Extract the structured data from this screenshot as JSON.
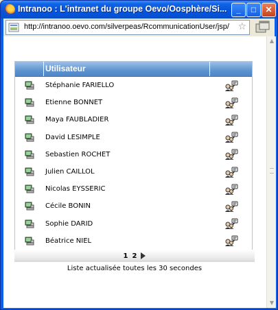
{
  "window": {
    "title": "Intranoo : L'intranet du groupe Oevo/Oosphère/Si..."
  },
  "address_bar": {
    "url": "http://intranoo.oevo.com/silverpeas/RcommunicationUser/jsp/"
  },
  "table": {
    "header": "Utilisateur",
    "users": [
      "Stéphanie FARIELLO",
      "Etienne BONNET",
      "Maya FAUBLADIER",
      "David LESIMPLE",
      "Sebastien ROCHET",
      "Julien CAILLOL",
      "Nicolas EYSSERIC",
      "Cécile BONIN",
      "Sophie DARID",
      "Béatrice NIEL"
    ]
  },
  "pagination": {
    "pages": [
      "1",
      "2"
    ]
  },
  "footer": {
    "refresh_text": "Liste actualisée toutes les 30 secondes"
  },
  "icons": {
    "user": "user-computer-icon",
    "action": "send-message-icon"
  }
}
